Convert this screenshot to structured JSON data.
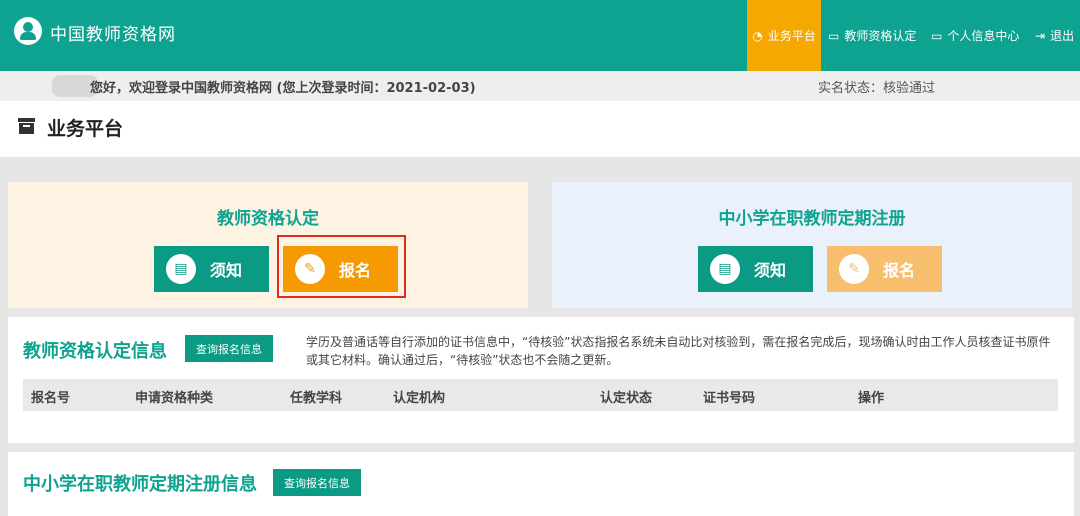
{
  "header": {
    "site_title": "中国教师资格网",
    "nav": [
      {
        "icon": "dashboard-icon",
        "label": "业务平台",
        "active": true
      },
      {
        "icon": "monitor-icon",
        "label": "教师资格认定",
        "active": false
      },
      {
        "icon": "monitor-icon",
        "label": "个人信息中心",
        "active": false
      },
      {
        "icon": "logout-icon",
        "label": "退出",
        "active": false
      }
    ]
  },
  "welcome": {
    "text": "您好，欢迎登录中国教师资格网 (您上次登录时间：2021-02-03)",
    "realname_status": "实名状态：核验通过"
  },
  "platform": {
    "title": "业务平台"
  },
  "cards": {
    "certification": {
      "title": "教师资格认定",
      "notice_label": "须知",
      "register_label": "报名"
    },
    "registration": {
      "title": "中小学在职教师定期注册",
      "notice_label": "须知",
      "register_label": "报名"
    }
  },
  "cert_info": {
    "title": "教师资格认定信息",
    "query_label": "查询报名信息",
    "note": "学历及普通话等自行添加的证书信息中，“待核验”状态指报名系统未自动比对核验到，需在报名完成后，现场确认时由工作人员核查证书原件或其它材料。确认通过后，“待核验”状态也不会随之更新。",
    "columns": [
      "报名号",
      "申请资格种类",
      "任教学科",
      "认定机构",
      "认定状态",
      "证书号码",
      "操作"
    ]
  },
  "reg_info": {
    "title": "中小学在职教师定期注册信息",
    "query_label": "查询报名信息"
  },
  "colors": {
    "brand": "#0ea390",
    "active_nav": "#f5a800",
    "button_teal": "#0b9a84",
    "button_orange": "#f59a00",
    "highlight": "#e02a1f"
  }
}
